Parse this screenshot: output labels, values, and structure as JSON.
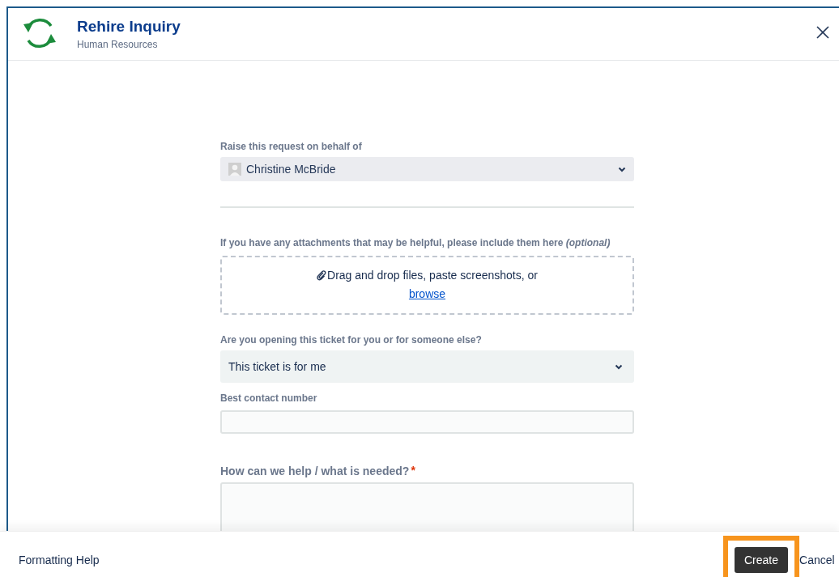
{
  "header": {
    "title": "Rehire Inquiry",
    "subtitle": "Human Resources"
  },
  "fields": [
    {
      "kind": "user-select",
      "label": "Raise this request on behalf of",
      "value": "Christine McBride"
    },
    {
      "kind": "attachment",
      "label": "If you have any attachments that may be helpful, please include them here *(optional)*",
      "prompt": "Drag and drop files, paste screenshots, or",
      "link": "browse"
    },
    {
      "kind": "select",
      "label": "Are you opening this ticket for you or for someone else?",
      "value": "This ticket is for me"
    },
    {
      "kind": "text",
      "label": "Best contact number"
    },
    {
      "kind": "textarea",
      "label": "How can we help / what is needed?",
      "required_mark": "*"
    }
  ],
  "footer": {
    "formatting_help": "Formatting Help",
    "buttons": [
      {
        "kind": "primary",
        "label": "Create",
        "highlighted": true
      },
      {
        "kind": "link",
        "label": "Cancel",
        "highlighted": false
      }
    ]
  }
}
